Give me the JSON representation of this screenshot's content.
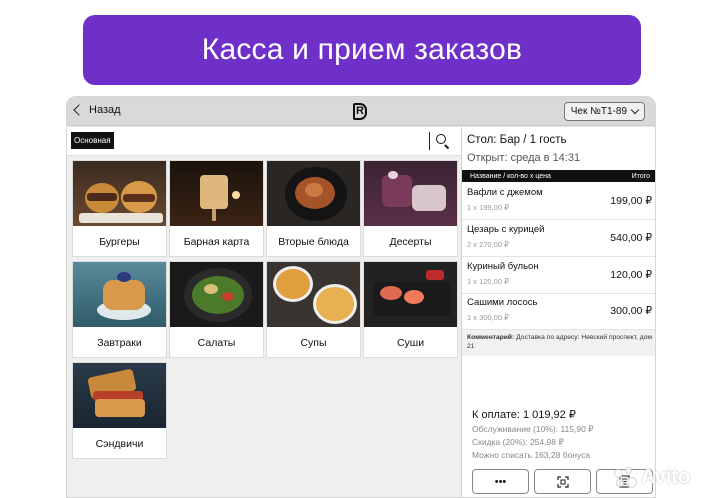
{
  "banner": {
    "title": "Касса и прием заказов"
  },
  "topbar": {
    "back_label": "Назад",
    "logo_letter": "R",
    "check_label": "Чек №T1-89"
  },
  "menu": {
    "active_tab": "Основная",
    "categories": [
      {
        "label": "Бургеры"
      },
      {
        "label": "Барная карта"
      },
      {
        "label": "Вторые блюда"
      },
      {
        "label": "Десерты"
      },
      {
        "label": "Завтраки"
      },
      {
        "label": "Салаты"
      },
      {
        "label": "Супы"
      },
      {
        "label": "Суши"
      },
      {
        "label": "Сэндвичи"
      }
    ]
  },
  "order": {
    "table": "Стол: Бар / 1 гость",
    "opened": "Открыт: среда в 14:31",
    "col_name": "Название / кол-во x цена",
    "col_total": "Итого",
    "items": [
      {
        "name": "Вафли с джемом",
        "qty": "1 x 199,00 ₽",
        "total": "199,00 ₽"
      },
      {
        "name": "Цезарь с курицей",
        "qty": "2 x 270,00 ₽",
        "total": "540,00 ₽"
      },
      {
        "name": "Куриный бульон",
        "qty": "1 x 120,00 ₽",
        "total": "120,00 ₽"
      },
      {
        "name": "Сашими лосось",
        "qty": "1 x 300,00 ₽",
        "total": "300,00 ₽"
      }
    ],
    "comment_label": "Комментарий:",
    "comment_text": "Доставка по адресу: Невский проспект, дом 21",
    "to_pay": "К оплате: 1 019,92 ₽",
    "service": "Обслуживание (10%): 115,90 ₽",
    "discount": "Скидка (20%): 254,98 ₽",
    "bonus": "Можно списать 163,28 бонуса",
    "more_label": "•••"
  },
  "watermark": {
    "text": "Avito"
  },
  "colors": {
    "banner": "#6f2fc9",
    "device_bg": "#e9e9e9",
    "header_bg": "#111111"
  }
}
